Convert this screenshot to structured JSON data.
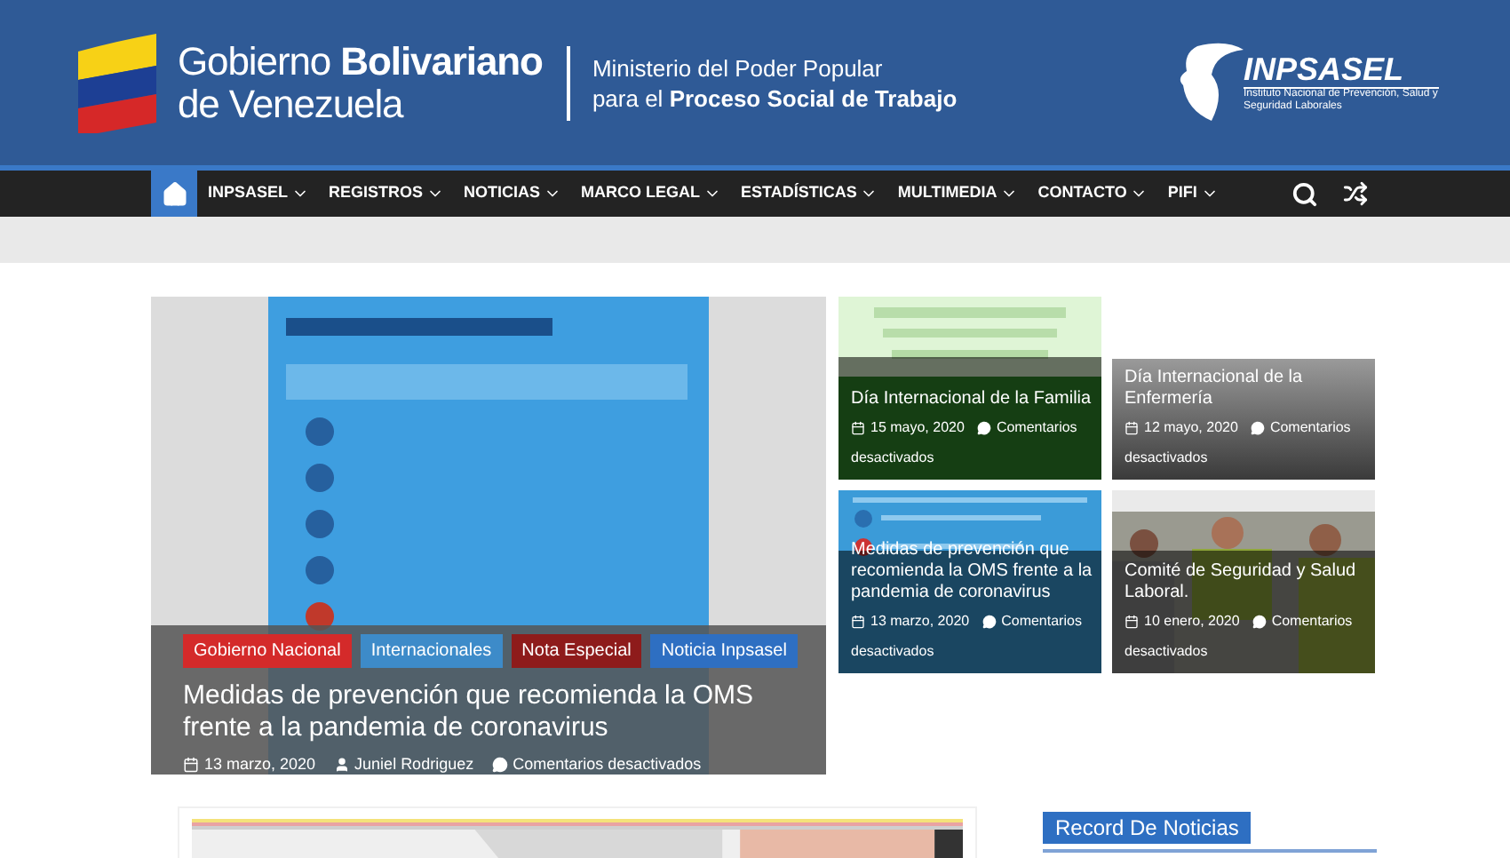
{
  "header": {
    "gov_title": "Gobierno **Bolivariano**",
    "gov_subtitle": "de Venezuela",
    "ministry_line1": "Ministerio del Poder Popular",
    "ministry_line2": "para el **Proceso Social de Trabajo**",
    "org_name": "INPSASEL",
    "org_full": "Instituto Nacional de Prevención, Salud y Seguridad Laborales"
  },
  "nav": {
    "items": [
      {
        "label": "INPSASEL"
      },
      {
        "label": "REGISTROS"
      },
      {
        "label": "NOTICIAS"
      },
      {
        "label": "MARCO LEGAL"
      },
      {
        "label": "ESTADÍSTICAS"
      },
      {
        "label": "MULTIMEDIA"
      },
      {
        "label": "CONTACTO"
      },
      {
        "label": "PIFI"
      }
    ]
  },
  "featured": {
    "tags": [
      {
        "label": "Gobierno Nacional",
        "color": "#d42a2a"
      },
      {
        "label": "Internacionales",
        "color": "#3d8bc9"
      },
      {
        "label": "Nota Especial",
        "color": "#8e1b1b"
      },
      {
        "label": "Noticia Inpsasel",
        "color": "#2e6fc2"
      }
    ],
    "title": "Medidas de prevención que recomienda la OMS frente a la pandemia de coronavirus",
    "date": "13 marzo, 2020",
    "author": "Juniel Rodriguez",
    "comments": "Comentarios desactivados"
  },
  "grid": [
    {
      "title": "Día Internacional de la Familia",
      "date": "15 mayo, 2020",
      "comments": "Comentarios",
      "comments2": "desactivados"
    },
    {
      "title": "Día Internacional de la Enfermería",
      "date": "12 mayo, 2020",
      "comments": "Comentarios",
      "comments2": "desactivados"
    },
    {
      "title": "Medidas de prevención que recomienda la OMS frente a la pandemia de coronavirus",
      "date": "13 marzo, 2020",
      "comments": "Comentarios",
      "comments2": "desactivados"
    },
    {
      "title": "Comité de Seguridad y Salud Laboral.",
      "date": "10 enero, 2020",
      "comments": "Comentarios",
      "comments2": "desactivados"
    }
  ],
  "sidebar": {
    "heading": "Record De Noticias"
  }
}
